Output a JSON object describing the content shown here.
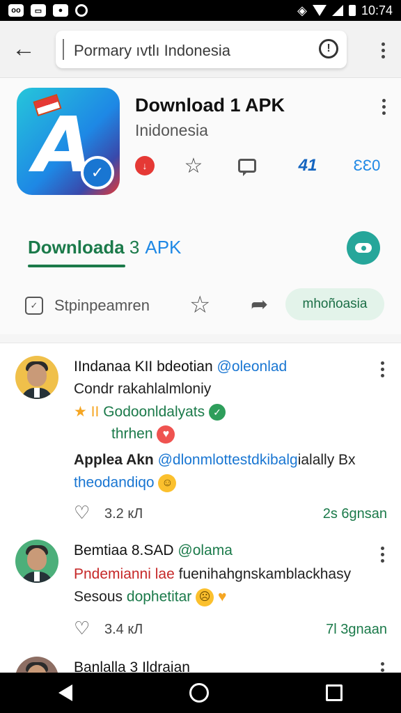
{
  "status_bar": {
    "time": "10:74",
    "left_icons": [
      "notification-icon",
      "gallery-icon",
      "camera-icon",
      "sync-icon"
    ],
    "right_icons": [
      "vibrate-icon",
      "wifi-icon",
      "signal-icon",
      "battery-icon"
    ]
  },
  "search": {
    "query": "Pormary ıvtlı Indonesia",
    "icons": [
      "back-arrow-icon",
      "info-icon",
      "more-vert-icon"
    ]
  },
  "app": {
    "title": "Download 1 APK",
    "subtitle": "Inidonesia",
    "action_chart_label": "41",
    "action_count_label": "ƐƐ0",
    "download_label": "Downloada",
    "download_num": "3",
    "download_apk": "APK",
    "tool_label": "Stpinpeamren",
    "chip_label": "mhoñoasia"
  },
  "comments": [
    {
      "name": "IIndanaa KII bdeotian",
      "handle": "@oleonlad",
      "line1": "Condr rakahlalmloniy",
      "line2_highlight": "Godoonldalyats",
      "line3": "thrhen",
      "line4_bold": "Applea Akn",
      "line4_handle": "@dlonmlottestdkibalg",
      "line4_rest": "ialally Bx",
      "line5": "theodandiqo",
      "likes": "3.2 кЛ",
      "time": "2s 6gnsan"
    },
    {
      "name": "Bemtiaa 8.SAD",
      "handle": "@olama",
      "line1_red": "Pndemianni lae",
      "line1_rest": "fuenihahgnskamblackhasy",
      "line2": "Sesous",
      "line2_green": "dophetitar",
      "likes": "3.4 кЛ",
      "time": "7l 3gnaan"
    },
    {
      "name": "Banlalla 3 Ildraian"
    }
  ],
  "colors": {
    "accent_green": "#1b7a4a",
    "accent_blue": "#1976d2",
    "fab_teal": "#26a69a",
    "status_black": "#000000"
  }
}
